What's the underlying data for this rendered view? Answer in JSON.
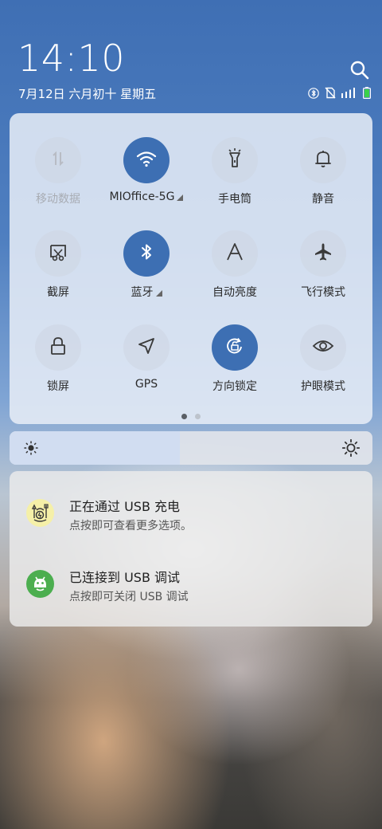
{
  "header": {
    "time": "14:10",
    "date": "7月12日 六月初十 星期五"
  },
  "status_icons": [
    "bluetooth-icon",
    "no-sim-icon",
    "signal-icon",
    "battery-icon"
  ],
  "quick_settings": {
    "tiles": [
      {
        "label": "移动数据",
        "icon": "mobile-data-icon",
        "state": "disabled"
      },
      {
        "label": "MIOffice-5G",
        "icon": "wifi-icon",
        "state": "on",
        "expandable": true
      },
      {
        "label": "手电筒",
        "icon": "flashlight-icon",
        "state": "off"
      },
      {
        "label": "静音",
        "icon": "bell-icon",
        "state": "off"
      },
      {
        "label": "截屏",
        "icon": "screenshot-icon",
        "state": "off"
      },
      {
        "label": "蓝牙",
        "icon": "bluetooth-icon",
        "state": "on",
        "expandable": true
      },
      {
        "label": "自动亮度",
        "icon": "auto-brightness-icon",
        "state": "off"
      },
      {
        "label": "飞行模式",
        "icon": "airplane-icon",
        "state": "off"
      },
      {
        "label": "锁屏",
        "icon": "lock-icon",
        "state": "off"
      },
      {
        "label": "GPS",
        "icon": "gps-icon",
        "state": "off"
      },
      {
        "label": "方向锁定",
        "icon": "rotation-lock-icon",
        "state": "on"
      },
      {
        "label": "护眼模式",
        "icon": "eye-icon",
        "state": "off"
      }
    ],
    "page_count": 2,
    "active_page": 1
  },
  "brightness": {
    "level": 0.47
  },
  "notifications": [
    {
      "title": "正在通过 USB 充电",
      "subtitle": "点按即可查看更多选项。",
      "icon": "usb-charging-icon"
    },
    {
      "title": "已连接到 USB 调试",
      "subtitle": "点按即可关闭 USB 调试",
      "icon": "android-debug-icon"
    }
  ],
  "colors": {
    "accent": "#3d6fb3",
    "usb_icon_bg": "#f5f0a8",
    "debug_icon_bg": "#4cae4f"
  }
}
